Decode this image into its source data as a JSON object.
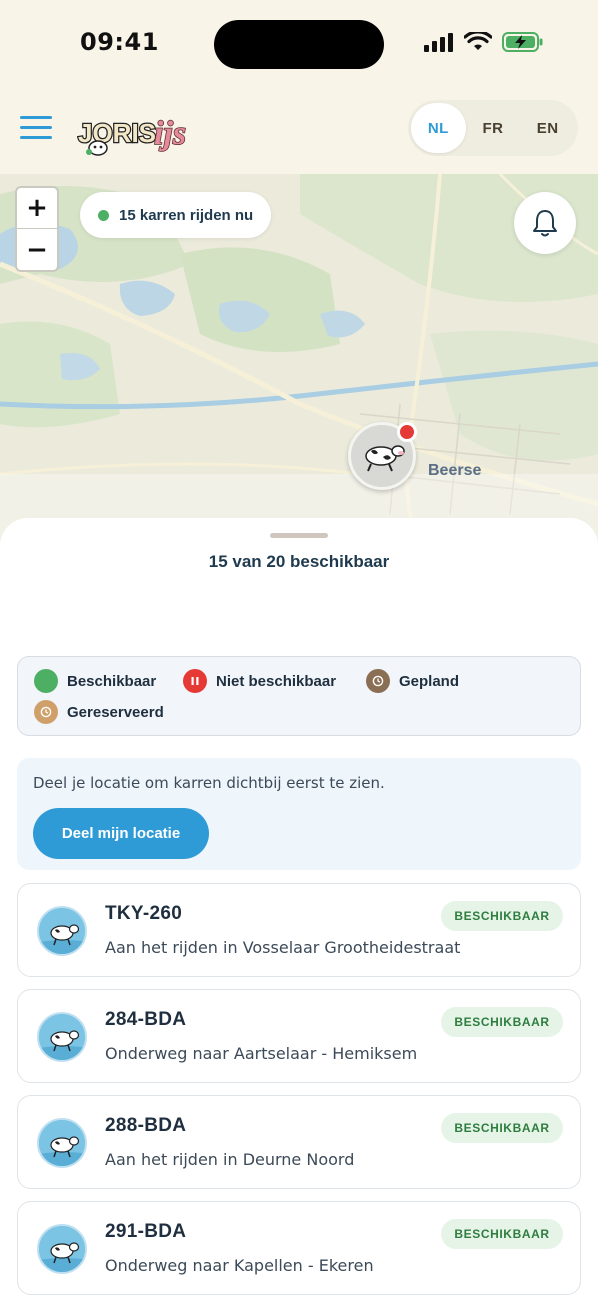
{
  "status_bar": {
    "time": "09:41"
  },
  "header": {
    "logo_text": "JORIS ijs",
    "languages": [
      {
        "code": "NL",
        "active": true
      },
      {
        "code": "FR",
        "active": false
      },
      {
        "code": "EN",
        "active": false
      }
    ]
  },
  "map": {
    "zoom_in_label": "+",
    "zoom_out_label": "−",
    "live_status": "15 karren rijden nu",
    "town_label": "Beerse",
    "marker_icon": "cow-icon"
  },
  "sheet": {
    "availability_title": "15 van 20 beschikbaar",
    "legend": [
      {
        "label": "Beschikbaar",
        "color": "#4caf63",
        "icon": "dot"
      },
      {
        "label": "Niet beschikbaar",
        "color": "#e53935",
        "icon": "pause-icon"
      },
      {
        "label": "Gepland",
        "color": "#8b6f55",
        "icon": "clock-icon"
      },
      {
        "label": "Gereserveerd",
        "color": "#d0a06a",
        "icon": "clock-icon"
      }
    ],
    "location_prompt": "Deel je locatie om karren dichtbij eerst te zien.",
    "share_location_button": "Deel mijn locatie",
    "carts": [
      {
        "plate": "TKY-260",
        "status": "BESCHIKBAAR",
        "description": "Aan het rijden in Vosselaar Grootheidestraat"
      },
      {
        "plate": "284-BDA",
        "status": "BESCHIKBAAR",
        "description": "Onderweg naar Aartselaar - Hemiksem"
      },
      {
        "plate": "288-BDA",
        "status": "BESCHIKBAAR",
        "description": "Aan het rijden in Deurne Noord"
      },
      {
        "plate": "291-BDA",
        "status": "BESCHIKBAAR",
        "description": "Onderweg naar Kapellen - Ekeren"
      }
    ]
  },
  "colors": {
    "accent": "#2f9bd6",
    "available": "#4caf63",
    "unavailable": "#e53935",
    "planned": "#8b6f55",
    "reserved": "#d0a06a"
  }
}
